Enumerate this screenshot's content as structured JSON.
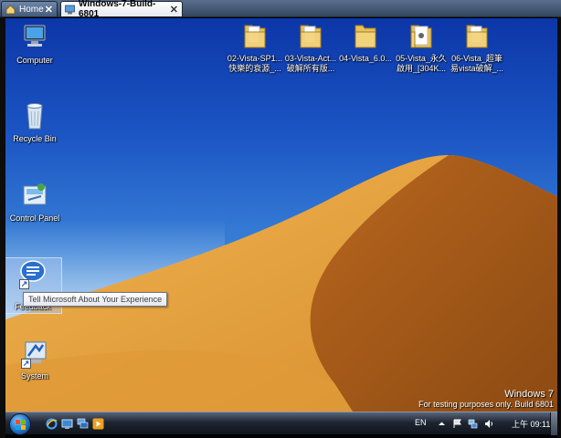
{
  "vm_tabs": [
    {
      "label": "Home",
      "icon": "home-icon"
    },
    {
      "label": "Windows-7-Build-6801",
      "icon": "vm-icon"
    }
  ],
  "desktop": {
    "system_icons": [
      {
        "label": "Computer",
        "icon": "computer-icon"
      },
      {
        "label": "Recycle Bin",
        "icon": "recycle-bin-icon"
      },
      {
        "label": "Control Panel",
        "icon": "control-panel-icon"
      },
      {
        "label": "Feedback",
        "icon": "feedback-icon"
      },
      {
        "label": "System",
        "icon": "system-icon"
      }
    ],
    "folders": [
      {
        "line1": "02-Vista-SP1...",
        "line2": "快樂的衰源_..."
      },
      {
        "line1": "03-Vista-Act...",
        "line2": "破解所有版..."
      },
      {
        "line1": "04-Vista_6.0...",
        "line2": ""
      },
      {
        "line1": "05-Vista_永久",
        "line2": "啟用_[304K..."
      },
      {
        "line1": "06-Vista_超筆",
        "line2": "易vista破解_..."
      }
    ],
    "tooltip": "Tell Microsoft About Your Experience",
    "watermark": {
      "line1": "Windows  7",
      "line2": "For testing purposes only. Build 6801"
    }
  },
  "taskbar": {
    "quick_launch": [
      "ie-icon",
      "show-desktop-ql-icon",
      "switch-windows-icon",
      "media-player-icon"
    ],
    "language": "EN",
    "tray_icons": [
      "tray-chevron-icon",
      "flag-icon",
      "network-icon",
      "volume-icon"
    ],
    "clock": "上午 09:11"
  },
  "colors": {
    "sky_top": "#0c36a8",
    "dune_light": "#e8a540",
    "dune_shadow": "#a8601c",
    "taskbar": "#1f2632"
  }
}
